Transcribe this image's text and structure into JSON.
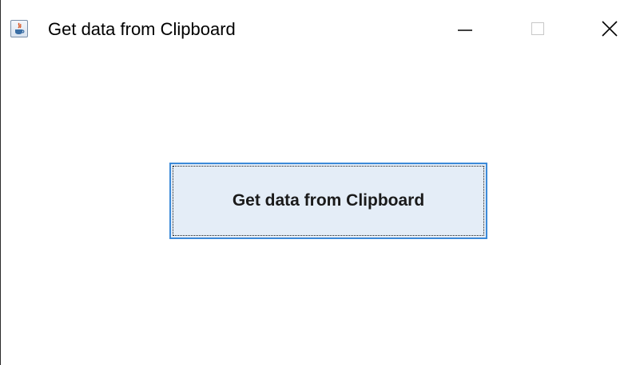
{
  "window": {
    "title": "Get data from Clipboard",
    "app_icon": "java-app-icon",
    "controls": {
      "minimize_icon": "minimize-icon",
      "maximize_icon": "maximize-icon",
      "close_icon": "close-icon"
    }
  },
  "main": {
    "button_label": "Get data from Clipboard"
  },
  "colors": {
    "button_background": "#e4edf7",
    "button_border": "#3c8ad8",
    "window_background": "#ffffff"
  }
}
